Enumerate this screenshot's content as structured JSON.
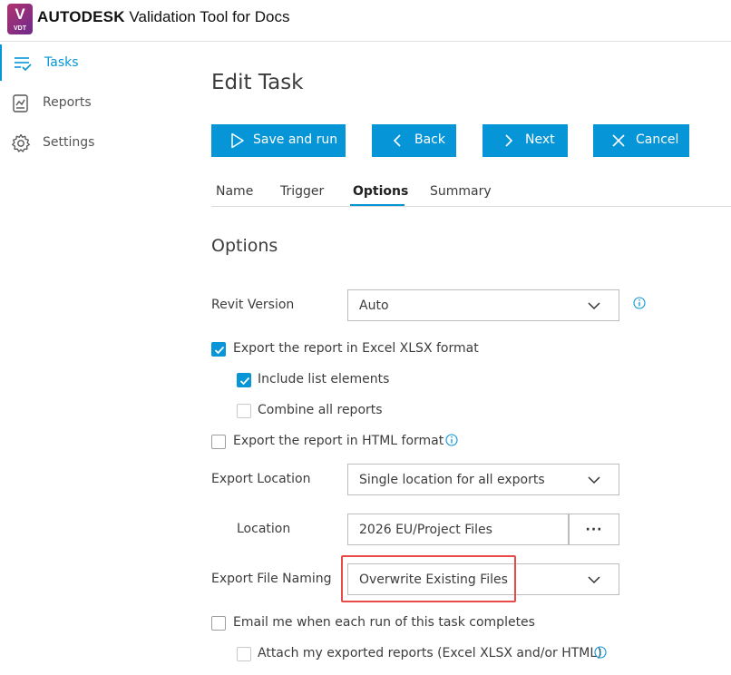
{
  "app": {
    "logo_letter": "V",
    "logo_sub": "VDT",
    "brand": "AUTODESK",
    "title": "Validation Tool for Docs"
  },
  "sidebar": {
    "items": [
      {
        "label": "Tasks",
        "icon": "tasks-list-icon",
        "active": true
      },
      {
        "label": "Reports",
        "icon": "report-chart-icon",
        "active": false
      },
      {
        "label": "Settings",
        "icon": "gear-icon",
        "active": false
      }
    ]
  },
  "page": {
    "title": "Edit Task"
  },
  "toolbar": {
    "save_run_label": "Save and run",
    "back_label": "Back",
    "next_label": "Next",
    "cancel_label": "Cancel"
  },
  "tabs": [
    {
      "label": "Name",
      "active": false
    },
    {
      "label": "Trigger",
      "active": false
    },
    {
      "label": "Options",
      "active": true
    },
    {
      "label": "Summary",
      "active": false
    }
  ],
  "options": {
    "section_title": "Options",
    "revit_version": {
      "label": "Revit Version",
      "value": "Auto"
    },
    "export_xlsx": {
      "label": "Export the report in Excel XLSX format",
      "checked": true
    },
    "include_list": {
      "label": "Include list elements",
      "checked": true
    },
    "combine_reports": {
      "label": "Combine all reports",
      "checked": false
    },
    "export_html": {
      "label": "Export the report in HTML format",
      "checked": false
    },
    "export_location": {
      "label": "Export Location",
      "value": "Single location for all exports"
    },
    "location": {
      "label": "Location",
      "value": "2026 EU/Project Files",
      "browse": "···"
    },
    "export_naming": {
      "label": "Export File Naming",
      "value": "Overwrite Existing Files"
    },
    "email_me": {
      "label": "Email me when each run of this task completes",
      "checked": false
    },
    "attach_reports": {
      "label": "Attach my exported reports (Excel XLSX and/or HTML)",
      "checked": false
    }
  },
  "colors": {
    "accent": "#0696d7",
    "highlight": "#e84a4a"
  }
}
